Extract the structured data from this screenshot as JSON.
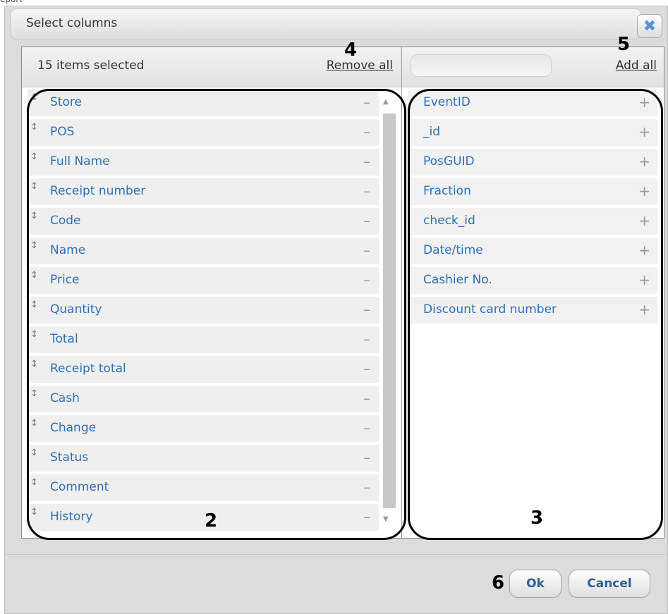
{
  "crop_text": "eport",
  "dialog": {
    "title": "Select columns",
    "close_icon": "close-x-icon"
  },
  "selected_panel": {
    "count_label": "15 items selected",
    "remove_all_label": "Remove all",
    "items": [
      {
        "label": "Store"
      },
      {
        "label": "POS"
      },
      {
        "label": "Full Name"
      },
      {
        "label": "Receipt number"
      },
      {
        "label": "Code"
      },
      {
        "label": "Name"
      },
      {
        "label": "Price"
      },
      {
        "label": "Quantity"
      },
      {
        "label": "Total"
      },
      {
        "label": "Receipt total"
      },
      {
        "label": "Cash"
      },
      {
        "label": "Change"
      },
      {
        "label": "Status"
      },
      {
        "label": "Comment"
      },
      {
        "label": "History"
      }
    ],
    "remove_symbol": "–",
    "drag_symbol": "↕"
  },
  "available_panel": {
    "search_placeholder": "",
    "add_all_label": "Add all",
    "items": [
      {
        "label": "EventID"
      },
      {
        "label": "_id"
      },
      {
        "label": "PosGUID"
      },
      {
        "label": "Fraction"
      },
      {
        "label": "check_id"
      },
      {
        "label": "Date/time"
      },
      {
        "label": "Cashier No."
      },
      {
        "label": "Discount card number"
      }
    ],
    "add_symbol": "+"
  },
  "annotations": {
    "n2": "2",
    "n3": "3",
    "n4": "4",
    "n5": "5",
    "n6": "6"
  },
  "footer": {
    "ok_label": "Ok",
    "cancel_label": "Cancel"
  },
  "colors": {
    "link_blue": "#2e6fb5",
    "background": "#dcdcdc"
  }
}
